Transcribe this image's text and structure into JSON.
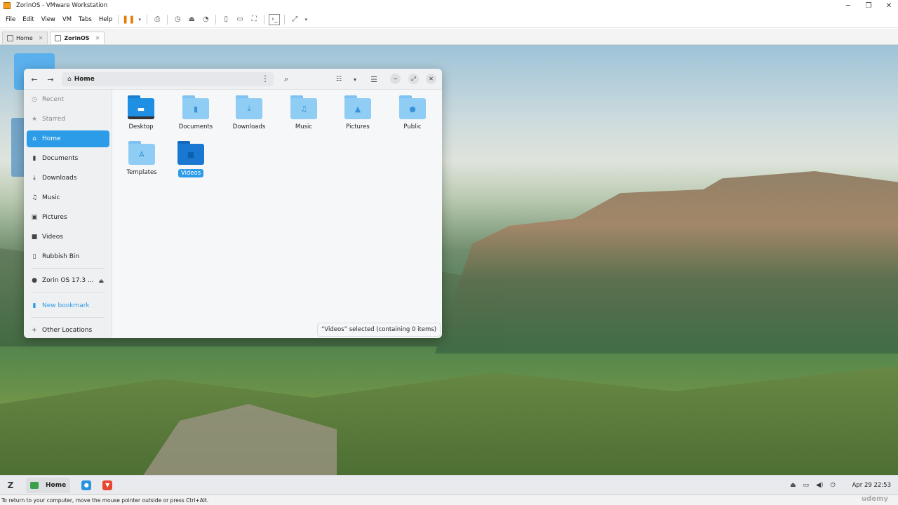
{
  "host": {
    "window_title": "ZorinOS - VMware Workstation",
    "menu": [
      "File",
      "Edit",
      "View",
      "VM",
      "Tabs",
      "Help"
    ],
    "tabs": [
      {
        "label": "Home",
        "active": false
      },
      {
        "label": "ZorinOS",
        "active": true
      }
    ],
    "status_hint": "To return to your computer, move the mouse pointer outside or press Ctrl+Alt.",
    "watermark": "udemy",
    "accent_color": "#e57a00"
  },
  "file_manager": {
    "path_label": "Home",
    "sidebar": {
      "items": [
        {
          "label": "Recent",
          "icon": "clock-icon",
          "state": "dim"
        },
        {
          "label": "Starred",
          "icon": "star-icon",
          "state": "dim"
        },
        {
          "label": "Home",
          "icon": "home-icon",
          "state": "active"
        },
        {
          "label": "Documents",
          "icon": "document-icon",
          "state": "normal"
        },
        {
          "label": "Downloads",
          "icon": "download-icon",
          "state": "normal"
        },
        {
          "label": "Music",
          "icon": "music-icon",
          "state": "normal"
        },
        {
          "label": "Pictures",
          "icon": "picture-icon",
          "state": "normal"
        },
        {
          "label": "Videos",
          "icon": "video-icon",
          "state": "normal"
        },
        {
          "label": "Rubbish Bin",
          "icon": "trash-icon",
          "state": "normal"
        }
      ],
      "drive": {
        "label": "Zorin OS 17.3 ...",
        "icon": "disc-icon"
      },
      "new_bookmark": "New bookmark",
      "other_locations": "Other Locations"
    },
    "folders": [
      {
        "label": "Desktop",
        "icon": "desktop-folder-icon"
      },
      {
        "label": "Documents",
        "icon": "documents-folder-icon"
      },
      {
        "label": "Downloads",
        "icon": "downloads-folder-icon"
      },
      {
        "label": "Music",
        "icon": "music-folder-icon"
      },
      {
        "label": "Pictures",
        "icon": "pictures-folder-icon"
      },
      {
        "label": "Public",
        "icon": "public-folder-icon"
      },
      {
        "label": "Templates",
        "icon": "templates-folder-icon"
      },
      {
        "label": "Videos",
        "icon": "videos-folder-icon",
        "selected": true
      }
    ],
    "status": "“Videos” selected  (containing 0 items)",
    "accent_color": "#2d9ce8"
  },
  "taskbar": {
    "task_label": "Home",
    "clock": "Apr 29  22:53"
  }
}
